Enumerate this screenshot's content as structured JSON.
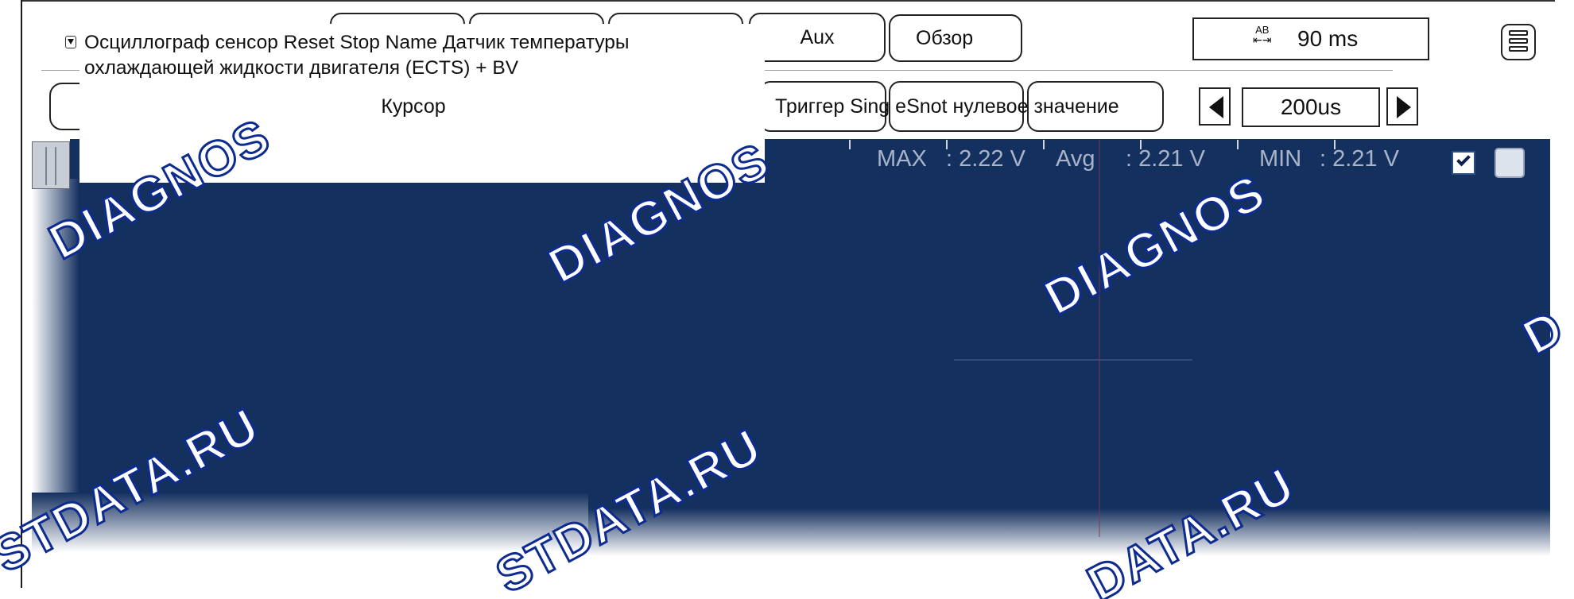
{
  "header": {
    "popup_title": "Осциллограф сенсор Reset Stop Name Датчик температуры охлаждающей жидкости двигателя (ECTS) + BV",
    "popup_cursor_label": "Курсор",
    "aux_label": "Aux",
    "overview_label": "Обзор",
    "ab_time_value": "90 ms",
    "ab_icon_top": "AB",
    "ab_icon_bottom": "⇤⇥",
    "trigger_text": "Триггер Sing eSnot нулевое значение",
    "timebase_value": "200us"
  },
  "stats": {
    "max_label": "MAX",
    "max_value": ": 2.22 V",
    "avg_label": "Avg",
    "avg_value": ": 2.21 V",
    "min_label": "MIN",
    "min_value": ": 2.21 V"
  },
  "checkbox": {
    "channel_enabled": true
  },
  "watermarks": {
    "w1": "DIAGNOS",
    "w2": "DIAGNOS",
    "w3": "DIAGNOS",
    "w4": "D",
    "w5": "STDATA.RU",
    "w6": "STDATA.RU",
    "w7": "DATA.RU"
  },
  "colors": {
    "plot_bg": "#14305f",
    "watermark_outline": "#0e2b8f",
    "stat_text": "#a9b4c8"
  }
}
